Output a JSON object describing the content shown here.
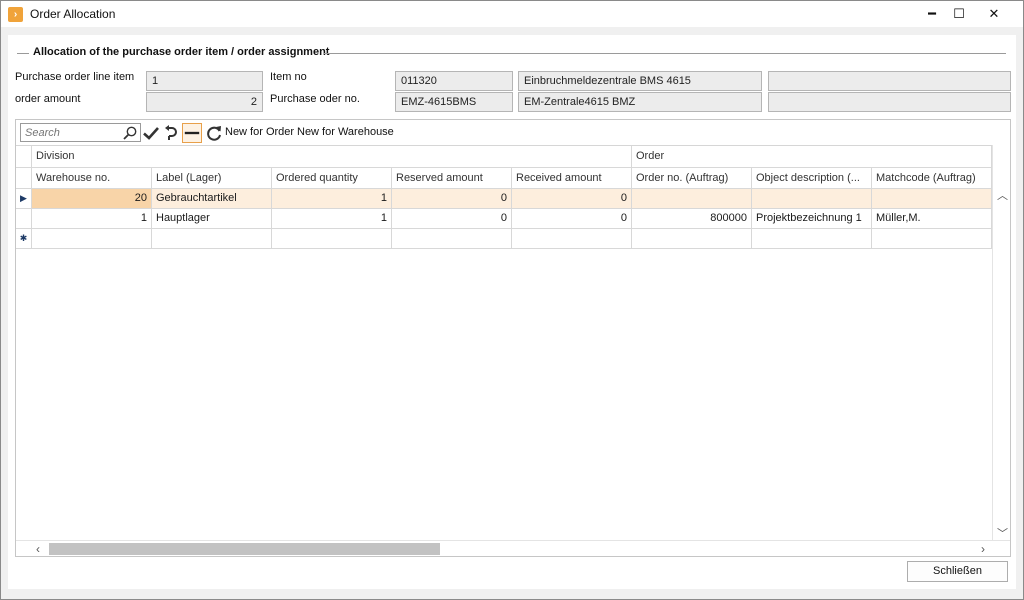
{
  "window": {
    "title": "Order Allocation",
    "minimize_glyph": "━",
    "maximize_glyph": "☐",
    "close_glyph": "✕"
  },
  "group": {
    "title": "Allocation of the purchase order item / order assignment"
  },
  "form": {
    "line_item_label": "Purchase order line item",
    "line_item_value": "1",
    "order_amount_label": "order amount",
    "order_amount_value": "2",
    "item_no_label": "Item no",
    "item_no_value": "011320",
    "item_desc_1": "Einbruchmeldezentrale BMS 4615",
    "item_extra_1": "",
    "purchase_order_label": "Purchase oder no.",
    "purchase_order_value": "EMZ-4615BMS",
    "item_desc_2": "EM-Zentrale4615 BMZ",
    "item_extra_2": ""
  },
  "toolbar": {
    "search_placeholder": "Search",
    "new_for_order_label": "New for Order",
    "new_for_warehouse_label": "New for Warehouse"
  },
  "grid": {
    "bands": [
      "Division",
      "Order"
    ],
    "columns": [
      "Warehouse no.",
      "Label (Lager)",
      "Ordered quantity",
      "Reserved amount",
      "Received amount",
      "Order no. (Auftrag)",
      "Object description (...",
      "Matchcode (Auftrag)"
    ],
    "rows": [
      [
        "20",
        "Gebrauchtartikel",
        "1",
        "0",
        "0",
        "",
        "",
        ""
      ],
      [
        "1",
        "Hauptlager",
        "1",
        "0",
        "0",
        "800000",
        "Projektbezeichnung 1",
        "Müller,M."
      ]
    ],
    "active_row_marker": "▶",
    "new_row_marker": "✱"
  },
  "footer": {
    "close_label": "Schließen"
  },
  "colors": {
    "accent": "#f0a33a",
    "active_row": "#fdeedd",
    "focused_cell": "#f8d4a8"
  },
  "icons": {
    "app": "app-icon",
    "search": "search-icon",
    "apply": "checkmark-icon",
    "undo": "undo-icon",
    "remove": "minus-icon",
    "refresh": "refresh-icon"
  }
}
